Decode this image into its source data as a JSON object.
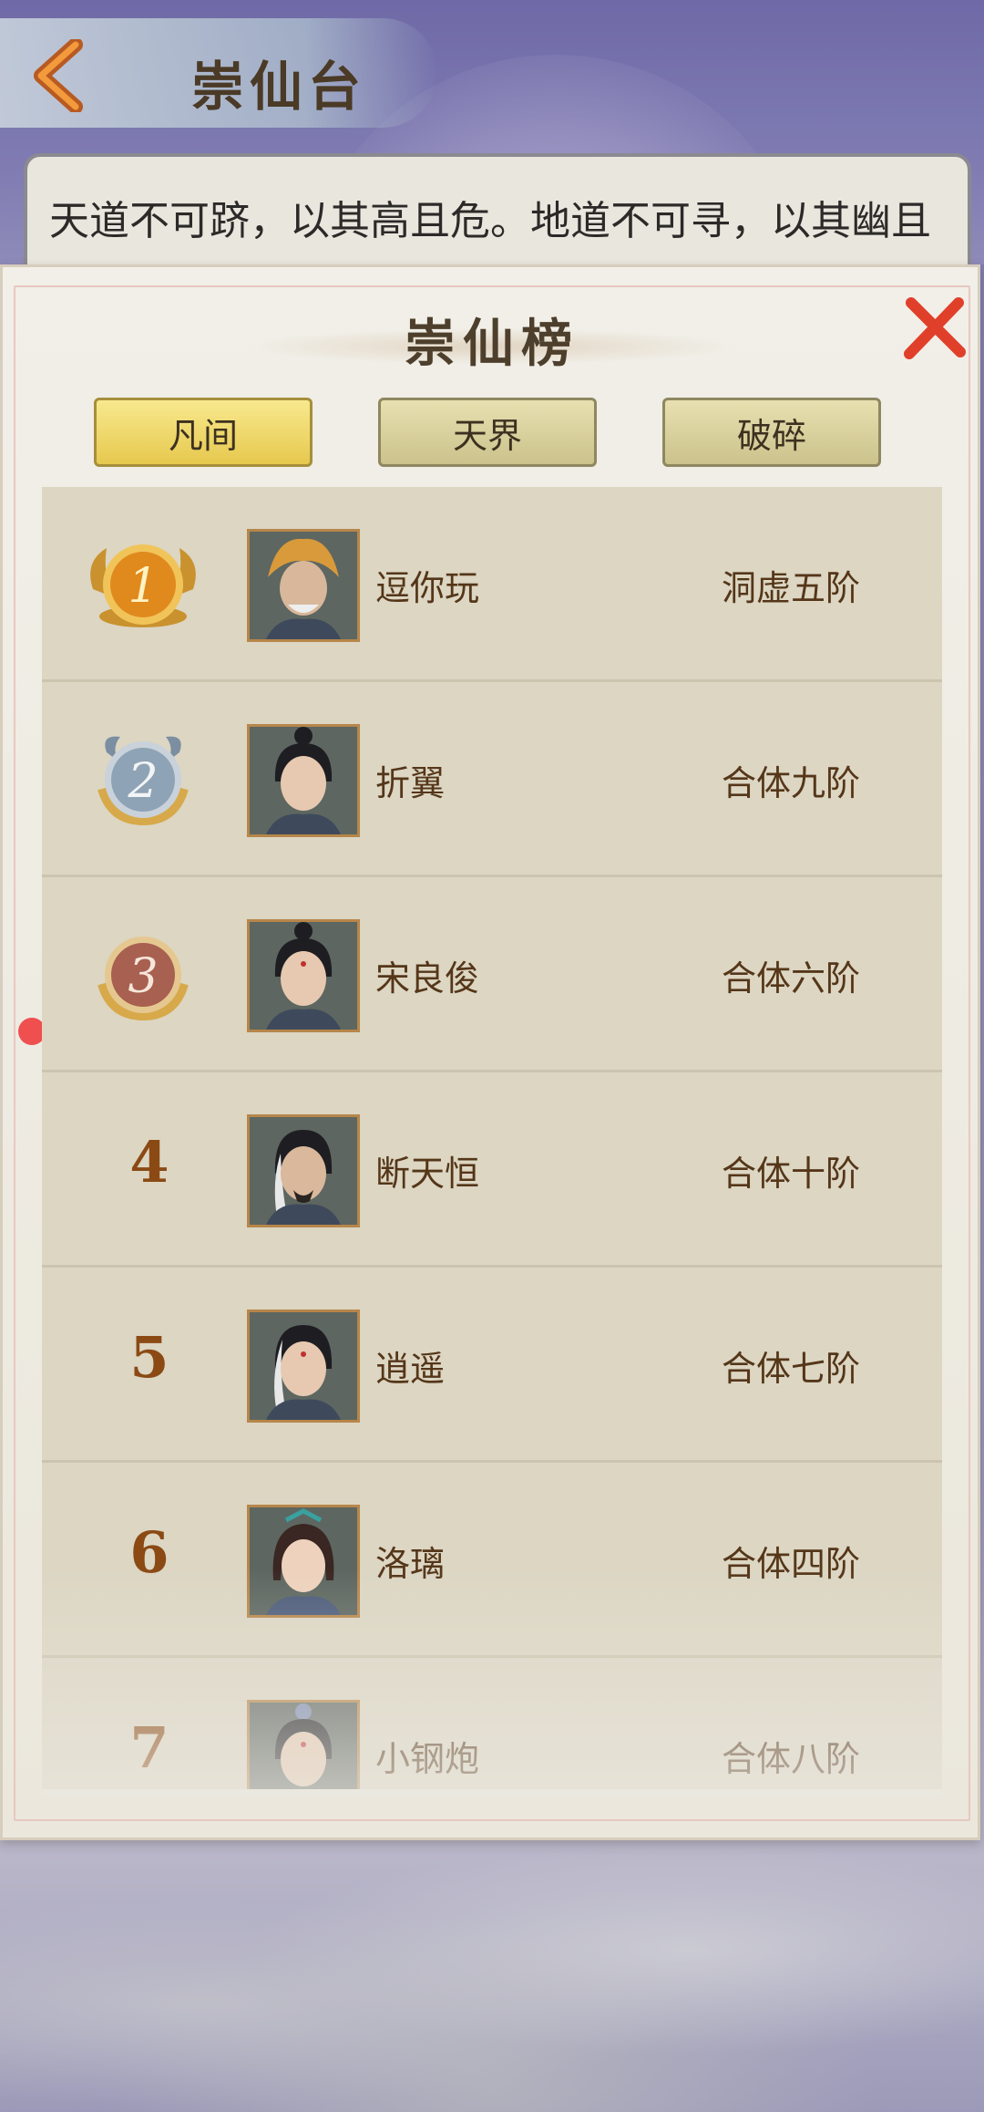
{
  "header": {
    "title": "崇仙台",
    "intro": "天道不可跻，以其高且危。地道不可寻，以其幽且"
  },
  "panel": {
    "title": "崇仙榜",
    "tabs": [
      {
        "label": "凡间",
        "active": true
      },
      {
        "label": "天界",
        "active": false
      },
      {
        "label": "破碎",
        "active": false
      }
    ],
    "rows": [
      {
        "rank": "1",
        "name": "逗你玩",
        "realm": "洞虚五阶",
        "medal": "gold"
      },
      {
        "rank": "2",
        "name": "折翼",
        "realm": "合体九阶",
        "medal": "silver"
      },
      {
        "rank": "3",
        "name": "宋良俊",
        "realm": "合体六阶",
        "medal": "bronze"
      },
      {
        "rank": "4",
        "name": "断天恒",
        "realm": "合体十阶"
      },
      {
        "rank": "5",
        "name": "逍遥",
        "realm": "合体七阶"
      },
      {
        "rank": "6",
        "name": "洛璃",
        "realm": "合体四阶"
      },
      {
        "rank": "7",
        "name": "小钢炮",
        "realm": "合体八阶"
      }
    ]
  },
  "colors": {
    "accent_gold": "#e6c84e",
    "text_brown": "#553619",
    "close_red": "#e0402a"
  }
}
